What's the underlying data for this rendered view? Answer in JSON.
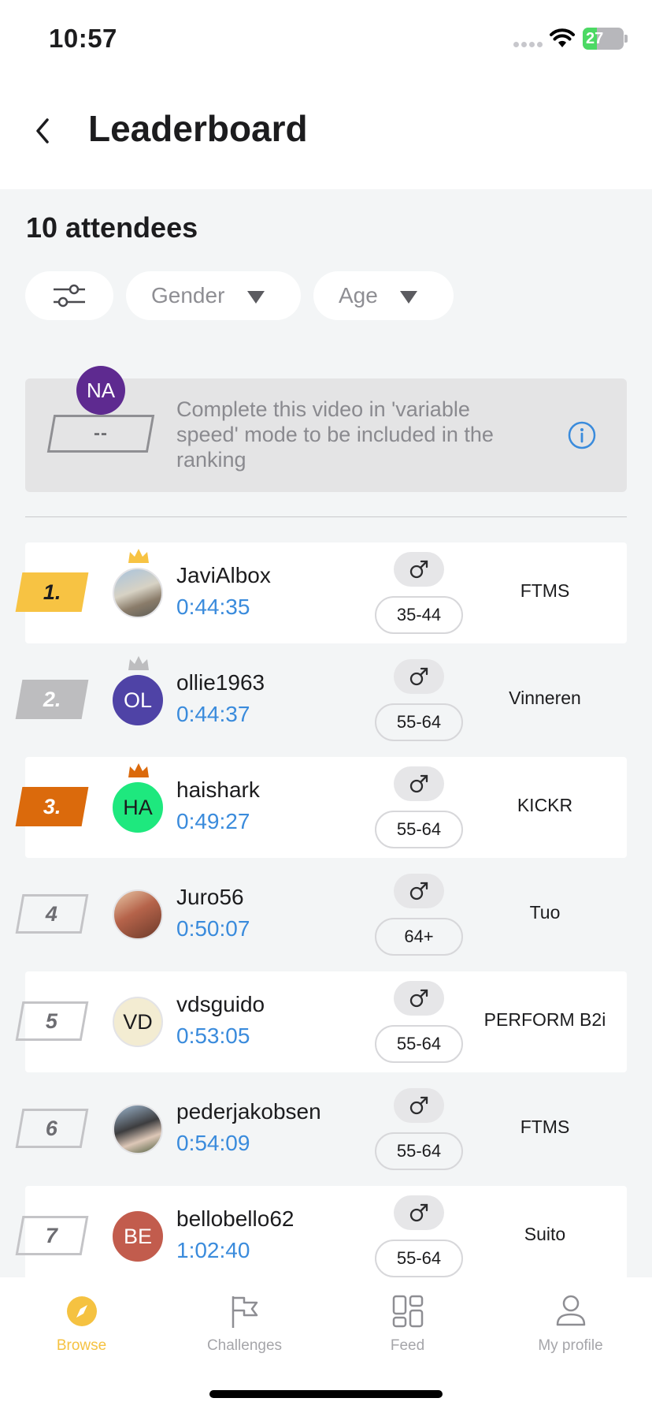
{
  "status_bar": {
    "time": "10:57",
    "battery": "27"
  },
  "header": {
    "title": "Leaderboard"
  },
  "attendees_label": "10 attendees",
  "filters": {
    "gender": "Gender",
    "age": "Age"
  },
  "user_box": {
    "initials": "NA",
    "avatar_color": "#5e2a90",
    "rank": "--",
    "note": "Complete this video in 'variable speed' mode to be included in the ranking"
  },
  "leaderboard": [
    {
      "rank": "1.",
      "name": "JaviAlbox",
      "time": "0:44:35",
      "age": "35-44",
      "device": "FTMS",
      "initials": ""
    },
    {
      "rank": "2.",
      "name": "ollie1963",
      "time": "0:44:37",
      "age": "55-64",
      "device": "Vinneren",
      "initials": "OL"
    },
    {
      "rank": "3.",
      "name": "haishark",
      "time": "0:49:27",
      "age": "55-64",
      "device": "KICKR",
      "initials": "HA"
    },
    {
      "rank": "4",
      "name": "Juro56",
      "time": "0:50:07",
      "age": "64+",
      "device": "Tuo",
      "initials": ""
    },
    {
      "rank": "5",
      "name": "vdsguido",
      "time": "0:53:05",
      "age": "55-64",
      "device": "PERFORM B2i",
      "initials": "VD"
    },
    {
      "rank": "6",
      "name": "pederjakobsen",
      "time": "0:54:09",
      "age": "55-64",
      "device": "FTMS",
      "initials": ""
    },
    {
      "rank": "7",
      "name": "bellobello62",
      "time": "1:02:40",
      "age": "55-64",
      "device": "Suito",
      "initials": "BE"
    }
  ],
  "colors": {
    "accent": "#f5c241",
    "time_blue": "#3a8bdc",
    "gold": "#f7c343",
    "silver": "#bdbdbf",
    "bronze": "#db6a0c"
  },
  "tabs": [
    {
      "label": "Browse",
      "icon": "compass-icon",
      "active": true
    },
    {
      "label": "Challenges",
      "icon": "flag-icon",
      "active": false
    },
    {
      "label": "Feed",
      "icon": "grid-icon",
      "active": false
    },
    {
      "label": "My profile",
      "icon": "person-icon",
      "active": false
    }
  ]
}
